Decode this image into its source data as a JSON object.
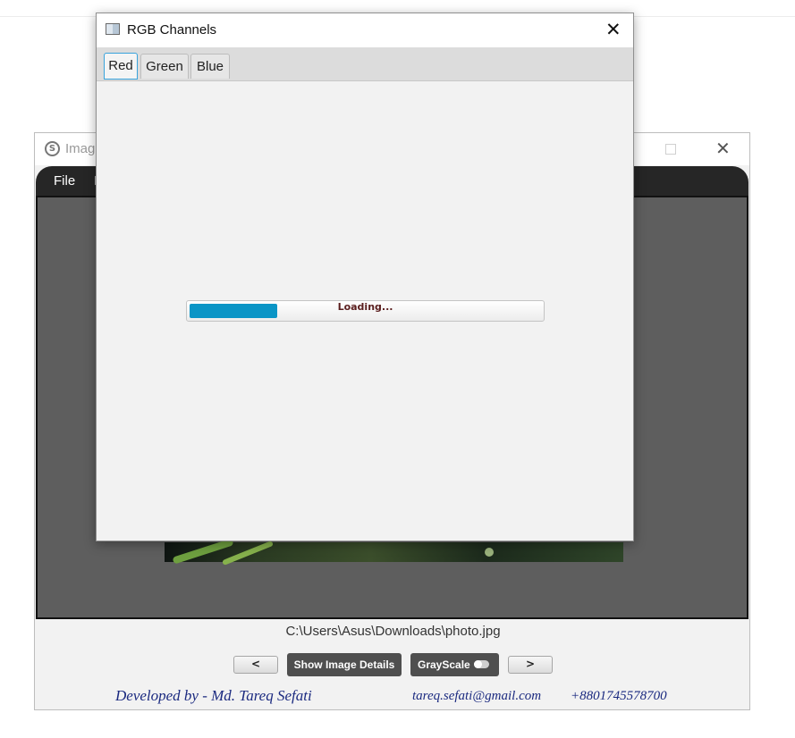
{
  "main_window": {
    "title": "Imag",
    "menu": [
      "File",
      "I"
    ],
    "file_path": "C:\\Users\\Asus\\Downloads\\photo.jpg",
    "buttons": {
      "prev": "<",
      "details": "Show Image Details",
      "grayscale": "GrayScale",
      "next": ">"
    },
    "grayscale_enabled": false,
    "footer": {
      "developer": "Developed by - Md. Tareq Sefati",
      "email": "tareq.sefati@gmail.com",
      "phone": "+8801745578700"
    }
  },
  "dialog": {
    "title": "RGB Channels",
    "tabs": [
      "Red",
      "Green",
      "Blue"
    ],
    "active_tab": "Red",
    "progress": {
      "label": "Loading...",
      "fraction": 0.25,
      "color": "#0a95c6"
    }
  },
  "icons": [
    "app-logo-icon",
    "maximize-icon",
    "close-icon",
    "dialog-window-icon",
    "dialog-close-icon"
  ]
}
